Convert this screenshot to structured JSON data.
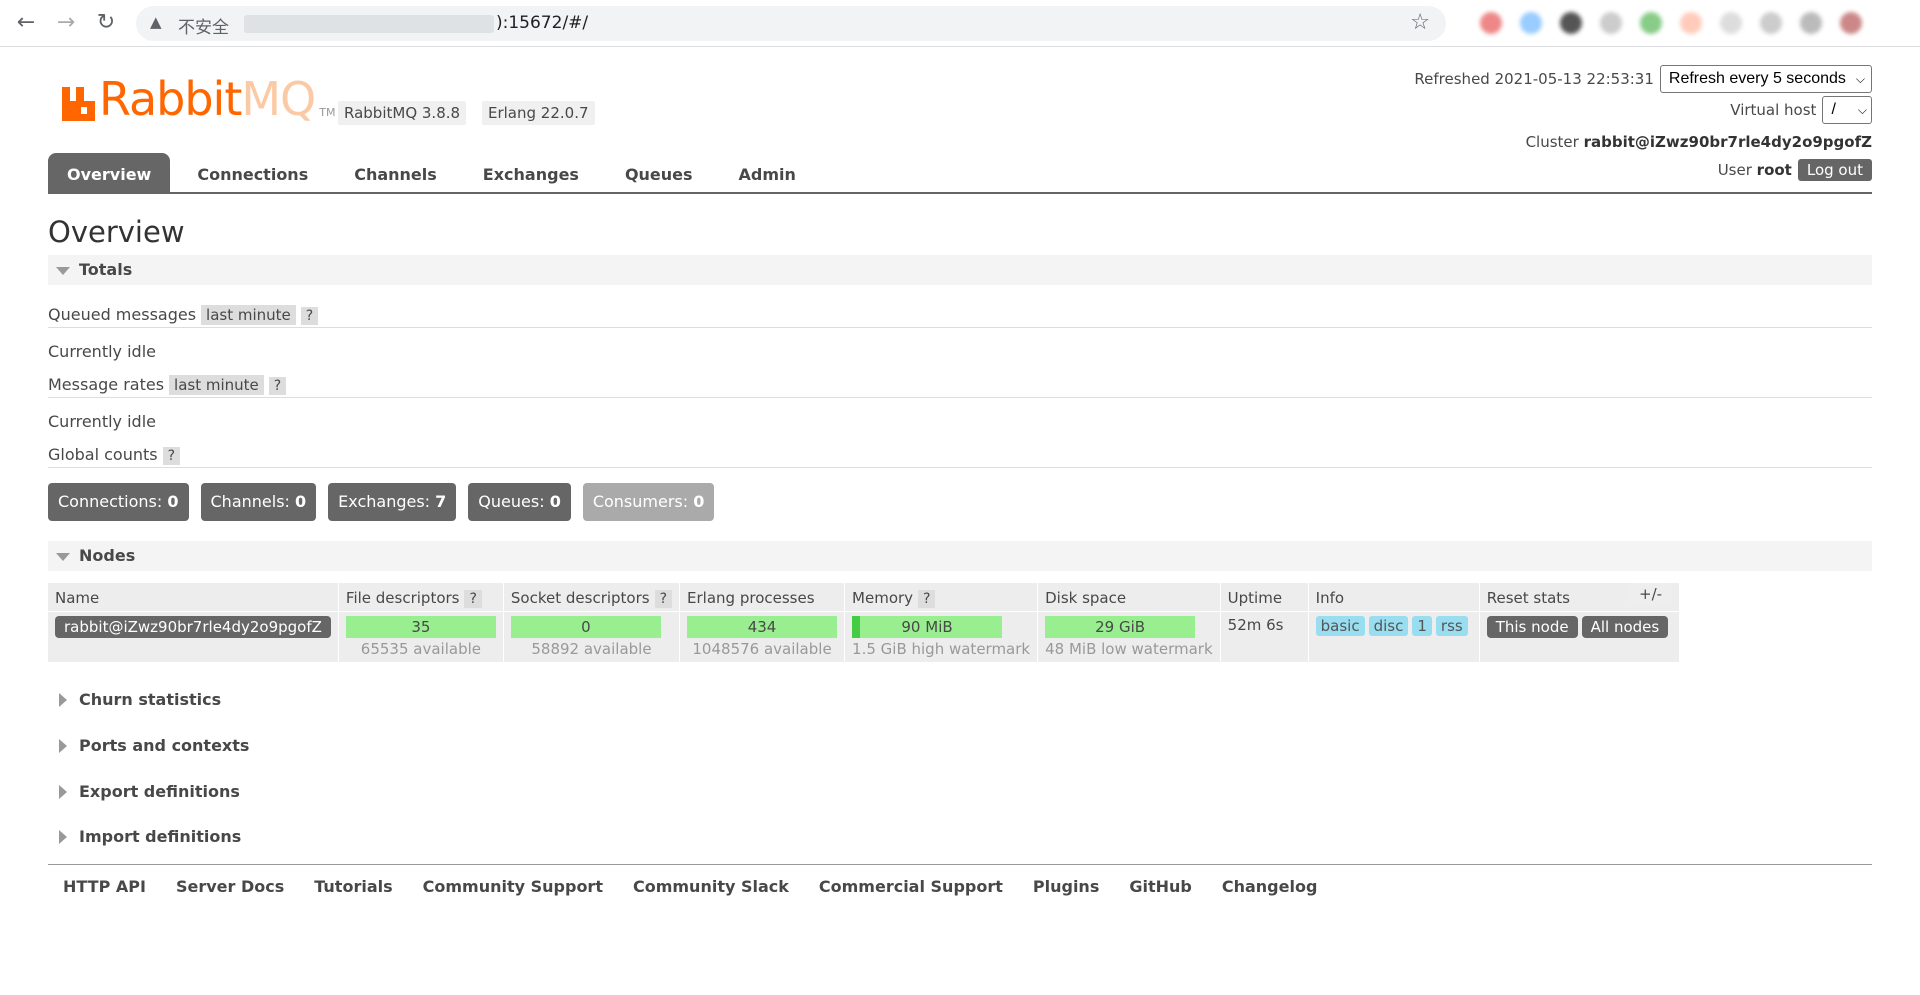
{
  "browser": {
    "security_label": "不安全",
    "url_visible": "):15672/#/"
  },
  "header": {
    "logo_text_rabbit": "Rabbit",
    "logo_text_mq": "MQ",
    "logo_tm": "TM",
    "rabbitmq_version": "RabbitMQ 3.8.8",
    "erlang_version": "Erlang 22.0.7",
    "refreshed_label": "Refreshed 2021-05-13 22:53:31",
    "refresh_select": "Refresh every 5 seconds",
    "vhost_label": "Virtual host",
    "vhost_select": "/",
    "cluster_label": "Cluster",
    "cluster_name": "rabbit@iZwz90br7rle4dy2o9pgofZ",
    "user_label": "User",
    "user_name": "root",
    "logout_label": "Log out"
  },
  "tabs": [
    {
      "label": "Overview",
      "active": true
    },
    {
      "label": "Connections"
    },
    {
      "label": "Channels"
    },
    {
      "label": "Exchanges"
    },
    {
      "label": "Queues"
    },
    {
      "label": "Admin"
    }
  ],
  "page_title": "Overview",
  "totals": {
    "heading": "Totals",
    "queued_messages_label": "Queued messages",
    "queued_messages_range": "last minute",
    "help": "?",
    "queued_status": "Currently idle",
    "message_rates_label": "Message rates",
    "message_rates_range": "last minute",
    "message_rates_status": "Currently idle",
    "global_counts_label": "Global counts",
    "counts": [
      {
        "label": "Connections:",
        "value": "0"
      },
      {
        "label": "Channels:",
        "value": "0"
      },
      {
        "label": "Exchanges:",
        "value": "7"
      },
      {
        "label": "Queues:",
        "value": "0"
      },
      {
        "label": "Consumers:",
        "value": "0"
      }
    ]
  },
  "nodes": {
    "heading": "Nodes",
    "columns": [
      "Name",
      "File descriptors",
      "Socket descriptors",
      "Erlang processes",
      "Memory",
      "Disk space",
      "Uptime",
      "Info",
      "Reset stats"
    ],
    "plus_minus": "+/-",
    "row": {
      "name": "rabbit@iZwz90br7rle4dy2o9pgofZ",
      "file_descriptors": "35",
      "file_descriptors_available": "65535 available",
      "socket_descriptors": "0",
      "socket_descriptors_available": "58892 available",
      "erlang_processes": "434",
      "erlang_processes_available": "1048576 available",
      "memory": "90 MiB",
      "memory_watermark": "1.5 GiB high watermark",
      "disk_space": "29 GiB",
      "disk_watermark": "48 MiB low watermark",
      "uptime": "52m 6s",
      "info_tags": [
        "basic",
        "disc",
        "1",
        "rss"
      ],
      "reset_this_node": "This node",
      "reset_all_nodes": "All nodes"
    }
  },
  "collapsed_sections": [
    "Churn statistics",
    "Ports and contexts",
    "Export definitions",
    "Import definitions"
  ],
  "footer_links": [
    "HTTP API",
    "Server Docs",
    "Tutorials",
    "Community Support",
    "Community Slack",
    "Commercial Support",
    "Plugins",
    "GitHub",
    "Changelog"
  ],
  "colors": {
    "brand": "#ff6600",
    "tab_active": "#666666",
    "bar_green": "#99ee90",
    "info_blue": "#99ddf0"
  }
}
